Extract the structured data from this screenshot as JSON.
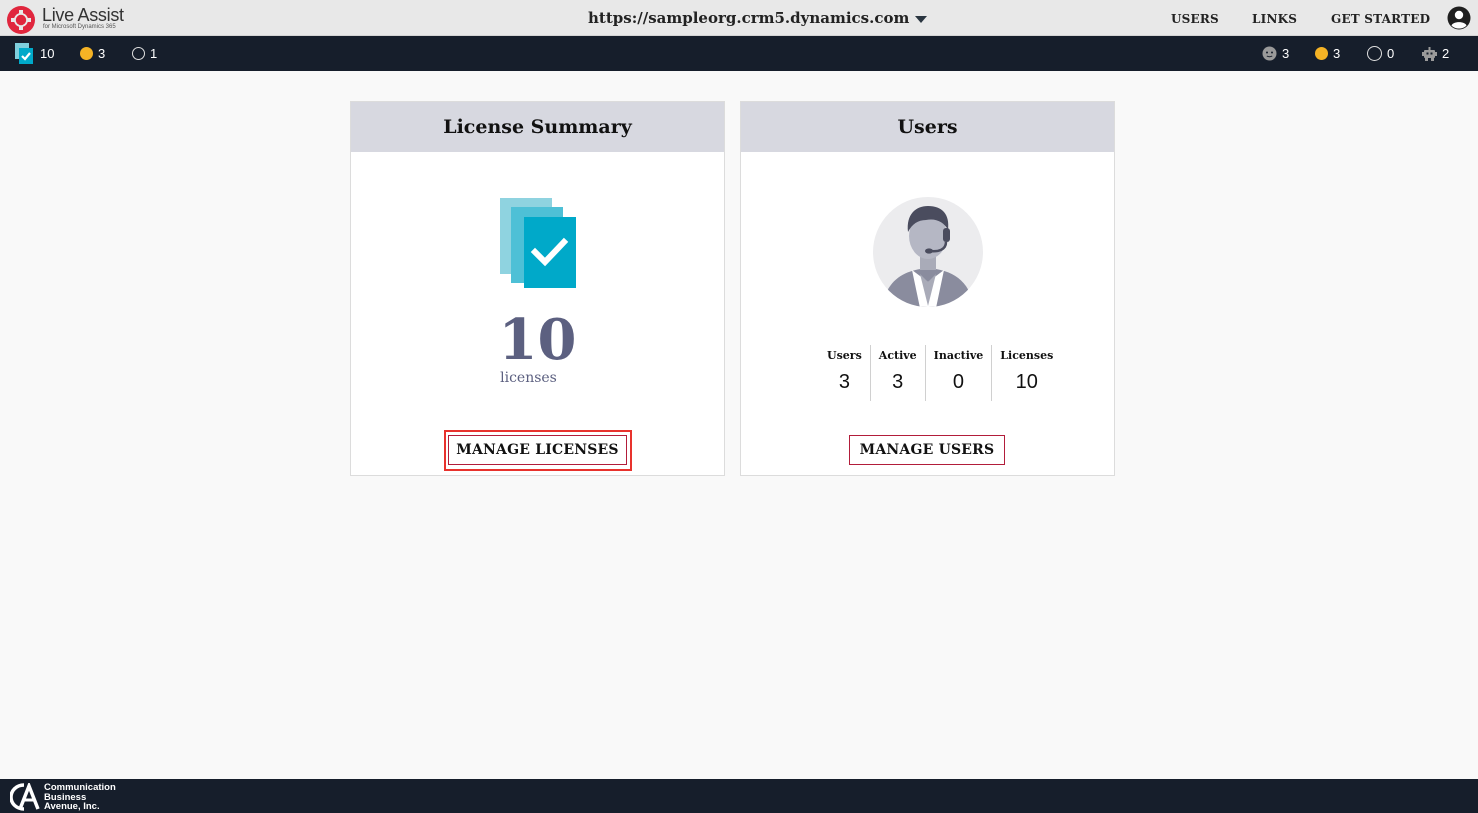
{
  "header": {
    "app_name": "Live Assist",
    "app_subtitle": "for Microsoft Dynamics 365",
    "org_url": "https://sampleorg.crm5.dynamics.com",
    "nav": {
      "users": "USERS",
      "links": "LINKS",
      "get_started": "GET STARTED"
    }
  },
  "statusbar": {
    "left": {
      "licenses": "10",
      "busy": "3",
      "offline": "1"
    },
    "right": {
      "away": "3",
      "busy": "3",
      "offline": "0",
      "bots": "2"
    }
  },
  "license_card": {
    "title": "License Summary",
    "count": "10",
    "unit": "licenses",
    "button": "MANAGE LICENSES"
  },
  "users_card": {
    "title": "Users",
    "stats": [
      {
        "label": "Users",
        "value": "3"
      },
      {
        "label": "Active",
        "value": "3"
      },
      {
        "label": "Inactive",
        "value": "0"
      },
      {
        "label": "Licenses",
        "value": "10"
      }
    ],
    "button": "MANAGE USERS"
  },
  "footer": {
    "company_line1": "Communication",
    "company_line2": "Business",
    "company_line3": "Avenue, Inc."
  },
  "colors": {
    "accent": "#b21d3a",
    "highlight": "#e8322d",
    "teal": "#00a9c9",
    "dark_bar": "#161e2b",
    "status_orange": "#f5b325"
  },
  "icons": {
    "logo": "lifebuoy-icon",
    "dropdown": "chevron-down-icon",
    "account": "user-circle-icon",
    "license": "license-check-icon",
    "agent": "headset-agent-icon",
    "away": "face-icon",
    "bots": "robot-icon"
  }
}
